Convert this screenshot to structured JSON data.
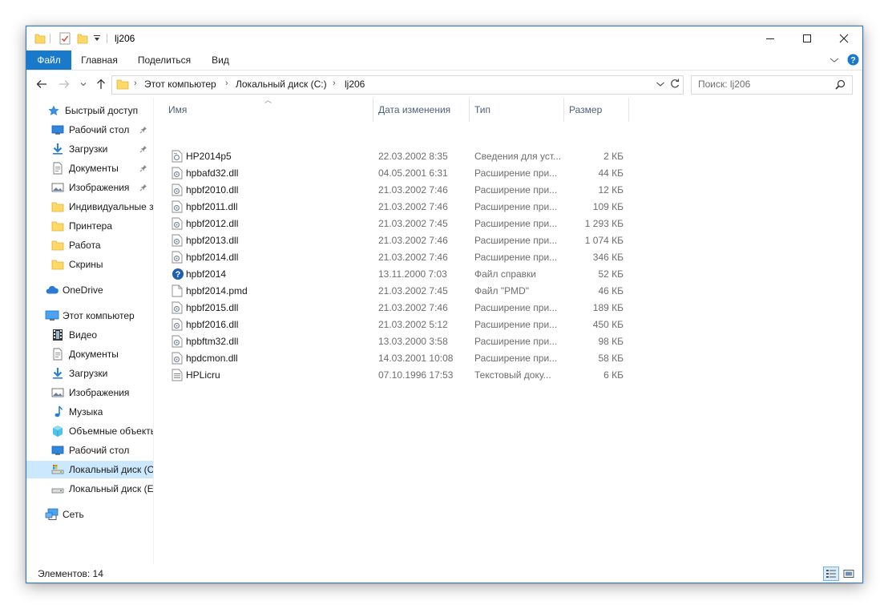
{
  "title": "lj206",
  "ribbon": {
    "tabs": [
      "Файл",
      "Главная",
      "Поделиться",
      "Вид"
    ]
  },
  "address": {
    "crumbs": [
      "Этот компьютер",
      "Локальный диск (C:)",
      "lj206"
    ]
  },
  "search": {
    "placeholder": "Поиск: lj206"
  },
  "nav": {
    "items": [
      {
        "label": "Быстрый доступ",
        "icon": "star-icon"
      },
      {
        "label": "Рабочий стол",
        "icon": "desktop-icon",
        "pinned": true
      },
      {
        "label": "Загрузки",
        "icon": "download-icon",
        "pinned": true
      },
      {
        "label": "Документы",
        "icon": "documents-icon",
        "pinned": true
      },
      {
        "label": "Изображения",
        "icon": "pictures-icon",
        "pinned": true
      },
      {
        "label": "Индивидуальные з",
        "icon": "folder-icon"
      },
      {
        "label": "Принтера",
        "icon": "folder-icon"
      },
      {
        "label": "Работа",
        "icon": "folder-icon"
      },
      {
        "label": "Скрины",
        "icon": "folder-icon"
      },
      {
        "label": "OneDrive",
        "icon": "cloud-icon"
      },
      {
        "label": "Этот компьютер",
        "icon": "computer-icon"
      },
      {
        "label": "Видео",
        "icon": "video-icon"
      },
      {
        "label": "Документы",
        "icon": "documents-icon"
      },
      {
        "label": "Загрузки",
        "icon": "download-icon"
      },
      {
        "label": "Изображения",
        "icon": "pictures-icon"
      },
      {
        "label": "Музыка",
        "icon": "music-icon"
      },
      {
        "label": "Объемные объекты",
        "icon": "3d-objects-icon"
      },
      {
        "label": "Рабочий стол",
        "icon": "desktop-icon"
      },
      {
        "label": "Локальный диск (C",
        "icon": "drive-c-icon",
        "selected": true
      },
      {
        "label": "Локальный диск (E",
        "icon": "drive-icon"
      },
      {
        "label": "Сеть",
        "icon": "network-icon"
      }
    ]
  },
  "columns": {
    "name": "Имя",
    "date": "Дата изменения",
    "type": "Тип",
    "size": "Размер"
  },
  "files": [
    {
      "name": "HP2014p5",
      "date": "22.03.2002 8:35",
      "type": "Сведения для уст...",
      "size": "2 КБ",
      "icon": "inf-file-icon"
    },
    {
      "name": "hpbafd32.dll",
      "date": "04.05.2001 6:31",
      "type": "Расширение при...",
      "size": "44 КБ",
      "icon": "dll-file-icon"
    },
    {
      "name": "hpbf2010.dll",
      "date": "21.03.2002 7:46",
      "type": "Расширение при...",
      "size": "12 КБ",
      "icon": "dll-file-icon"
    },
    {
      "name": "hpbf2011.dll",
      "date": "21.03.2002 7:46",
      "type": "Расширение при...",
      "size": "109 КБ",
      "icon": "dll-file-icon"
    },
    {
      "name": "hpbf2012.dll",
      "date": "21.03.2002 7:45",
      "type": "Расширение при...",
      "size": "1 293 КБ",
      "icon": "dll-file-icon"
    },
    {
      "name": "hpbf2013.dll",
      "date": "21.03.2002 7:46",
      "type": "Расширение при...",
      "size": "1 074 КБ",
      "icon": "dll-file-icon"
    },
    {
      "name": "hpbf2014.dll",
      "date": "21.03.2002 7:46",
      "type": "Расширение при...",
      "size": "346 КБ",
      "icon": "dll-file-icon"
    },
    {
      "name": "hpbf2014",
      "date": "13.11.2000 7:03",
      "type": "Файл справки",
      "size": "52 КБ",
      "icon": "help-file-icon"
    },
    {
      "name": "hpbf2014.pmd",
      "date": "21.03.2002 7:45",
      "type": "Файл \"PMD\"",
      "size": "46 КБ",
      "icon": "blank-file-icon"
    },
    {
      "name": "hpbf2015.dll",
      "date": "21.03.2002 7:46",
      "type": "Расширение при...",
      "size": "189 КБ",
      "icon": "dll-file-icon"
    },
    {
      "name": "hpbf2016.dll",
      "date": "21.03.2002 5:12",
      "type": "Расширение при...",
      "size": "450 КБ",
      "icon": "dll-file-icon"
    },
    {
      "name": "hpbftm32.dll",
      "date": "13.03.2000 3:58",
      "type": "Расширение при...",
      "size": "98 КБ",
      "icon": "dll-file-icon"
    },
    {
      "name": "hpdcmon.dll",
      "date": "14.03.2001 10:08",
      "type": "Расширение при...",
      "size": "58 КБ",
      "icon": "dll-file-icon"
    },
    {
      "name": "HPLicru",
      "date": "07.10.1996 17:53",
      "type": "Текстовый доку...",
      "size": "6 КБ",
      "icon": "text-file-icon"
    }
  ],
  "status": {
    "items_count": "Элементов: 14"
  },
  "colors": {
    "accent": "#1979ca",
    "selected": "#cce8ff",
    "folder": "#ffd866"
  }
}
